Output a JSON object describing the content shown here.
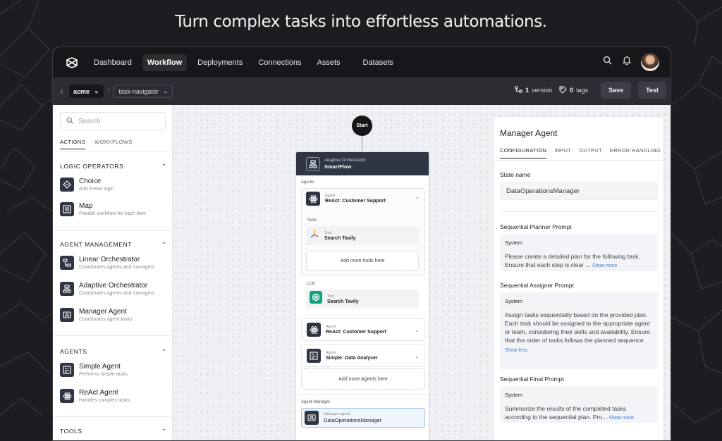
{
  "headline": "Turn complex tasks into effortless automations.",
  "topnav": {
    "items": [
      "Dashboard",
      "Workflow",
      "Deployments",
      "Connections",
      "Assets",
      "Datasets"
    ],
    "active": "Workflow"
  },
  "subbar": {
    "org": "acme",
    "project": "task-navigator",
    "version_count": "1",
    "version_label": "version",
    "tag_count": "0",
    "tag_label": "tags",
    "save_label": "Save",
    "test_label": "Test"
  },
  "sidebar": {
    "search_placeholder": "Search",
    "tabs": [
      "ACTIONS",
      "WORKFLOWS"
    ],
    "sections": [
      {
        "title": "LOGIC OPERATORS",
        "items": [
          {
            "name": "Choice",
            "desc": "Add if-else logic",
            "icon": "choice-icon"
          },
          {
            "name": "Map",
            "desc": "Parallel workflow for each item",
            "icon": "map-icon"
          }
        ]
      },
      {
        "title": "AGENT MANAGEMENT",
        "items": [
          {
            "name": "Linear Orchestrator",
            "desc": "Coordinates agents and managers",
            "icon": "linear-orchestrator-icon"
          },
          {
            "name": "Adaptive Orchestrator",
            "desc": "Coordinates agents and managers",
            "icon": "adaptive-orchestrator-icon"
          },
          {
            "name": "Manager Agent",
            "desc": "Coordinates agent tasks",
            "icon": "manager-agent-icon"
          }
        ]
      },
      {
        "title": "AGENTS",
        "items": [
          {
            "name": "Simple Agent",
            "desc": "Performs simple tasks",
            "icon": "simple-agent-icon"
          },
          {
            "name": "ReAct Agent",
            "desc": "Handles complex tasks",
            "icon": "react-agent-icon"
          }
        ]
      },
      {
        "title": "TOOLS",
        "items": []
      }
    ]
  },
  "canvas": {
    "start_label": "Start",
    "orchestrator": {
      "type": "Adaptive Orchestrator",
      "name": "SmartFlow"
    },
    "agents_label": "Agents",
    "agent1": {
      "type": "Agent",
      "name": "ReAct: Customer Support"
    },
    "tools_label": "Tools",
    "tool1": {
      "type": "Tool",
      "name": "Search Tavily"
    },
    "add_tools_label": "Add more tools here",
    "llm_label": "LLM",
    "llm_tool": {
      "type": "Tool",
      "name": "Search Tavily"
    },
    "agent2": {
      "type": "Agent",
      "name": "ReAct: Customer Support"
    },
    "agent3": {
      "type": "Agent",
      "name": "Simple: Data Analyser"
    },
    "add_agents_label": "Add more Agents here",
    "manager_label": "Agent Manager",
    "manager": {
      "type": "Manager agent",
      "name": "DataOperationsManager"
    }
  },
  "panel": {
    "title": "Manager Agent",
    "tabs": [
      "CONFIGURATION",
      "INPUT",
      "OUTPUT",
      "ERROR HANDLING"
    ],
    "state_name_label": "State name",
    "state_name_value": "DataOperationsManager",
    "planner": {
      "label": "Sequential Planner Prompt",
      "role": "System",
      "text": "Please create a detailed plan for the following task. Ensure that each step is clear ...",
      "link": "Show more"
    },
    "assigner": {
      "label": "Sequential Assigner Prompt",
      "role": "System",
      "text": "Assign tasks sequentially based on the provided plan. Each task should be assigned to the appropriate agent or team, considering their skills and availability. Ensure that the order of tasks follows the planned sequence.",
      "link": "Show less"
    },
    "final": {
      "label": "Sequential Final Prompt",
      "role": "System",
      "text": "Summarize the results of the completed tasks according to the sequential plan. Pro...",
      "link": "Show more"
    }
  }
}
